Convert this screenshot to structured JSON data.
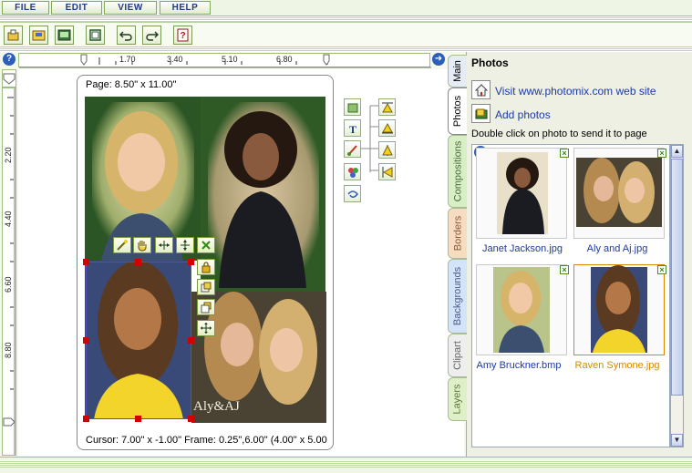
{
  "menu": {
    "file": "FILE",
    "edit": "EDIT",
    "view": "VIEW",
    "help": "HELP"
  },
  "toolbar": {
    "icons": [
      "open-icon",
      "save-icon",
      "print-icon",
      "frame-icon",
      "undo-icon",
      "redo-icon",
      "help-book-icon"
    ]
  },
  "ruler": {
    "h_marks": [
      "1.70",
      "3.40",
      "5.10",
      "6.80"
    ],
    "v_marks": [
      "2.20",
      "4.40",
      "6.60",
      "8.80"
    ]
  },
  "canvas": {
    "page_size": "Page: 8.50\" x 11.00\"",
    "status": "Cursor: 7.00\" x -1.00\" Frame: 0.25\",6.00\" (4.00\" x 5.00",
    "collage_caption": "Aly&AJ"
  },
  "tabs": [
    "Main",
    "Photos",
    "Compositions",
    "Borders",
    "Backgrounds",
    "Clipart",
    "Layers"
  ],
  "panel": {
    "title": "Photos",
    "visit_link": "Visit www.photomix.com web site",
    "add_photos": "Add photos",
    "instruction": "Double click on photo to send it to page",
    "photos": [
      {
        "name": "Janet Jackson.jpg",
        "selected": false
      },
      {
        "name": "Aly and Aj.jpg",
        "selected": false
      },
      {
        "name": "Amy Bruckner.bmp",
        "selected": false
      },
      {
        "name": "Raven Symone.jpg",
        "selected": true
      }
    ]
  },
  "colors": {
    "link": "#1c3aa8",
    "selected_label": "#d68a00",
    "accent_green": "#8fc06b"
  }
}
